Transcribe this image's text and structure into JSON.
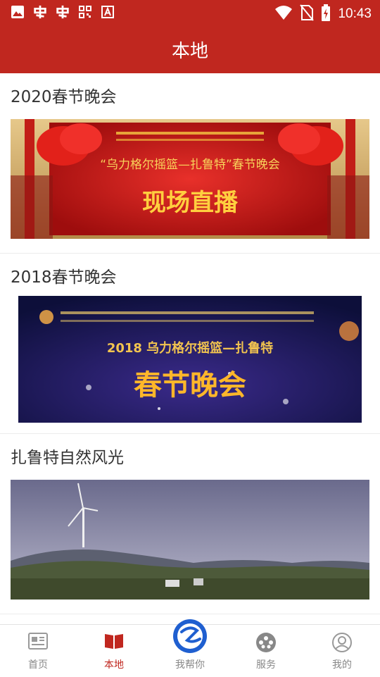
{
  "status_bar": {
    "time": "10:43",
    "left_icons": [
      "image-icon",
      "notification-app-icon",
      "notification-app-icon",
      "qr-app-icon",
      "keyboard-app-icon"
    ],
    "right_icons": [
      "wifi-icon",
      "no-sim-icon",
      "battery-charging-icon"
    ]
  },
  "header": {
    "title": "本地"
  },
  "cards": [
    {
      "title": "2020春节晚会",
      "banner_text": "“乌力格尔摇篮—扎鲁特”春节晚会",
      "banner_subtext": "现场直播"
    },
    {
      "title": "2018春节晚会",
      "banner_text": "2018 乌力格尔摇篮—扎鲁特",
      "banner_subtext": "春节晚会"
    },
    {
      "title": "扎鲁特自然风光"
    }
  ],
  "tabbar": {
    "tabs": [
      {
        "label": "首页",
        "icon": "newspaper-icon",
        "active": false
      },
      {
        "label": "本地",
        "icon": "book-icon",
        "active": true
      },
      {
        "label": "我帮你",
        "icon": "help-logo-icon",
        "active": false
      },
      {
        "label": "服务",
        "icon": "service-icon",
        "active": false
      },
      {
        "label": "我的",
        "icon": "user-icon",
        "active": false
      }
    ]
  },
  "colors": {
    "brand": "#c0271f",
    "tab_inactive": "#888888",
    "title_text": "#333333"
  }
}
